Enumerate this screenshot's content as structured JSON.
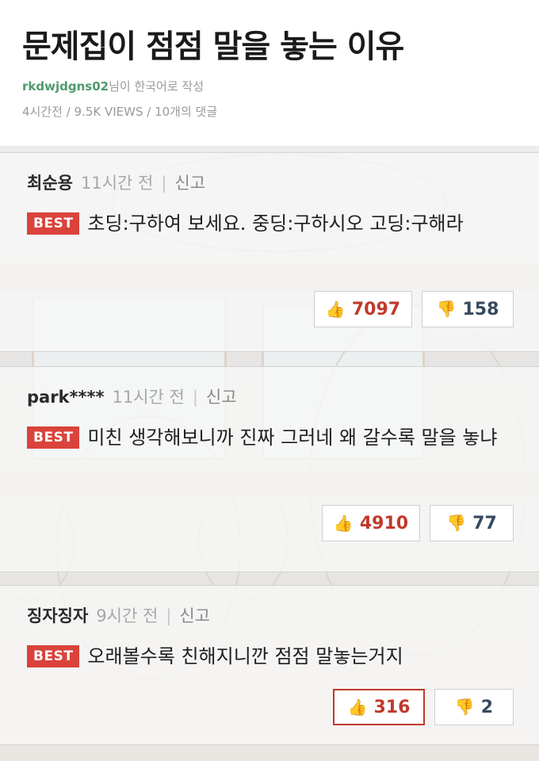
{
  "post": {
    "title": "문제집이 점점 말을 놓는 이유",
    "author": "rkdwjdgns02",
    "author_suffix": "님이 한국어로 작성",
    "stats": "4시간전 / 9.5K VIEWS / 10개의 댓글"
  },
  "comments": [
    {
      "nickname": "최순용",
      "time": "11시간 전",
      "report": "신고",
      "badge": "BEST",
      "text": "초딩:구하여 보세요. 중딩:구하시오 고딩:구해라",
      "likes": "7097",
      "dislikes": "158"
    },
    {
      "nickname": "park****",
      "time": "11시간 전",
      "report": "신고",
      "badge": "BEST",
      "text": "미친 생각해보니까 진짜 그러네 왜 갈수록 말을 놓냐",
      "likes": "4910",
      "dislikes": "77"
    },
    {
      "nickname": "징자징자",
      "time": "9시간 전",
      "report": "신고",
      "badge": "BEST",
      "text": "오래볼수록 친해지니깐 점점 말놓는거지",
      "likes": "316",
      "dislikes": "2"
    }
  ],
  "icons": {
    "like": "thumbs-up-icon",
    "dislike": "thumbs-down-icon"
  },
  "colors": {
    "best_badge": "#d9433b",
    "like_count": "#c0392b",
    "dislike_count": "#37495e",
    "author": "#4f9a6a"
  }
}
